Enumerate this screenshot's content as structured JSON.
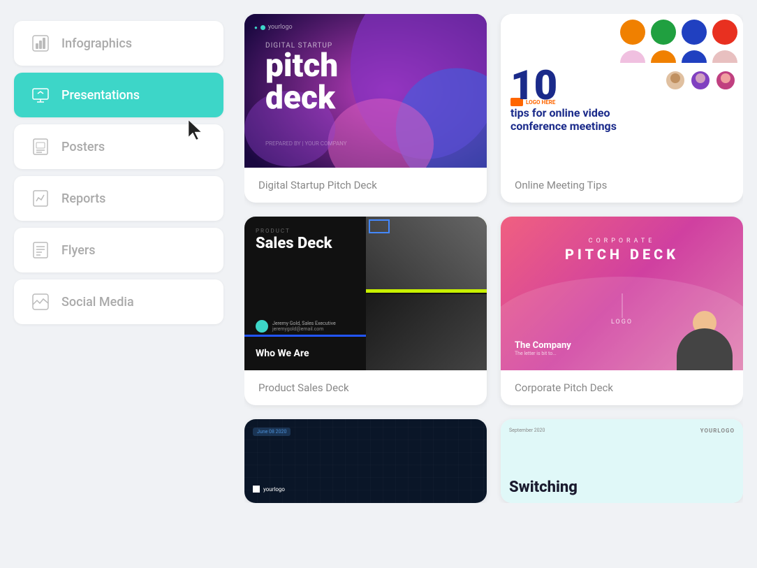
{
  "sidebar": {
    "items": [
      {
        "id": "infographics",
        "label": "Infographics",
        "active": false
      },
      {
        "id": "presentations",
        "label": "Presentations",
        "active": true
      },
      {
        "id": "posters",
        "label": "Posters",
        "active": false
      },
      {
        "id": "reports",
        "label": "Reports",
        "active": false
      },
      {
        "id": "flyers",
        "label": "Flyers",
        "active": false
      },
      {
        "id": "social-media",
        "label": "Social Media",
        "active": false
      }
    ]
  },
  "cards": [
    {
      "id": "digital-startup",
      "label": "Digital Startup Pitch Deck",
      "logo": "yourlogo",
      "title_small": "digital startup",
      "title_big": "pitch deck"
    },
    {
      "id": "online-meeting",
      "label": "Online Meeting Tips",
      "logo": "LOGO HERE",
      "number": "10",
      "text": "tips for online video conference meetings"
    },
    {
      "id": "product-sales",
      "label": "Product Sales Deck",
      "tag": "PRODUCT",
      "title": "Sales Deck",
      "who": "Who We Are",
      "person_name": "Jeremy Gold, Sales Executive",
      "person_email": "jeremygold@email.com"
    },
    {
      "id": "corporate-pitch",
      "label": "Corporate Pitch Deck",
      "small": "CORPORATE",
      "big": "PITCH DECK",
      "company": "The Company",
      "logo": "LOGO"
    },
    {
      "id": "dark-building",
      "label": "",
      "date": "June 08 2020",
      "logo": "yourlogo"
    },
    {
      "id": "switching",
      "label": "",
      "date": "September 2020",
      "brand": "YOURLOGO",
      "title": "Switching"
    }
  ]
}
